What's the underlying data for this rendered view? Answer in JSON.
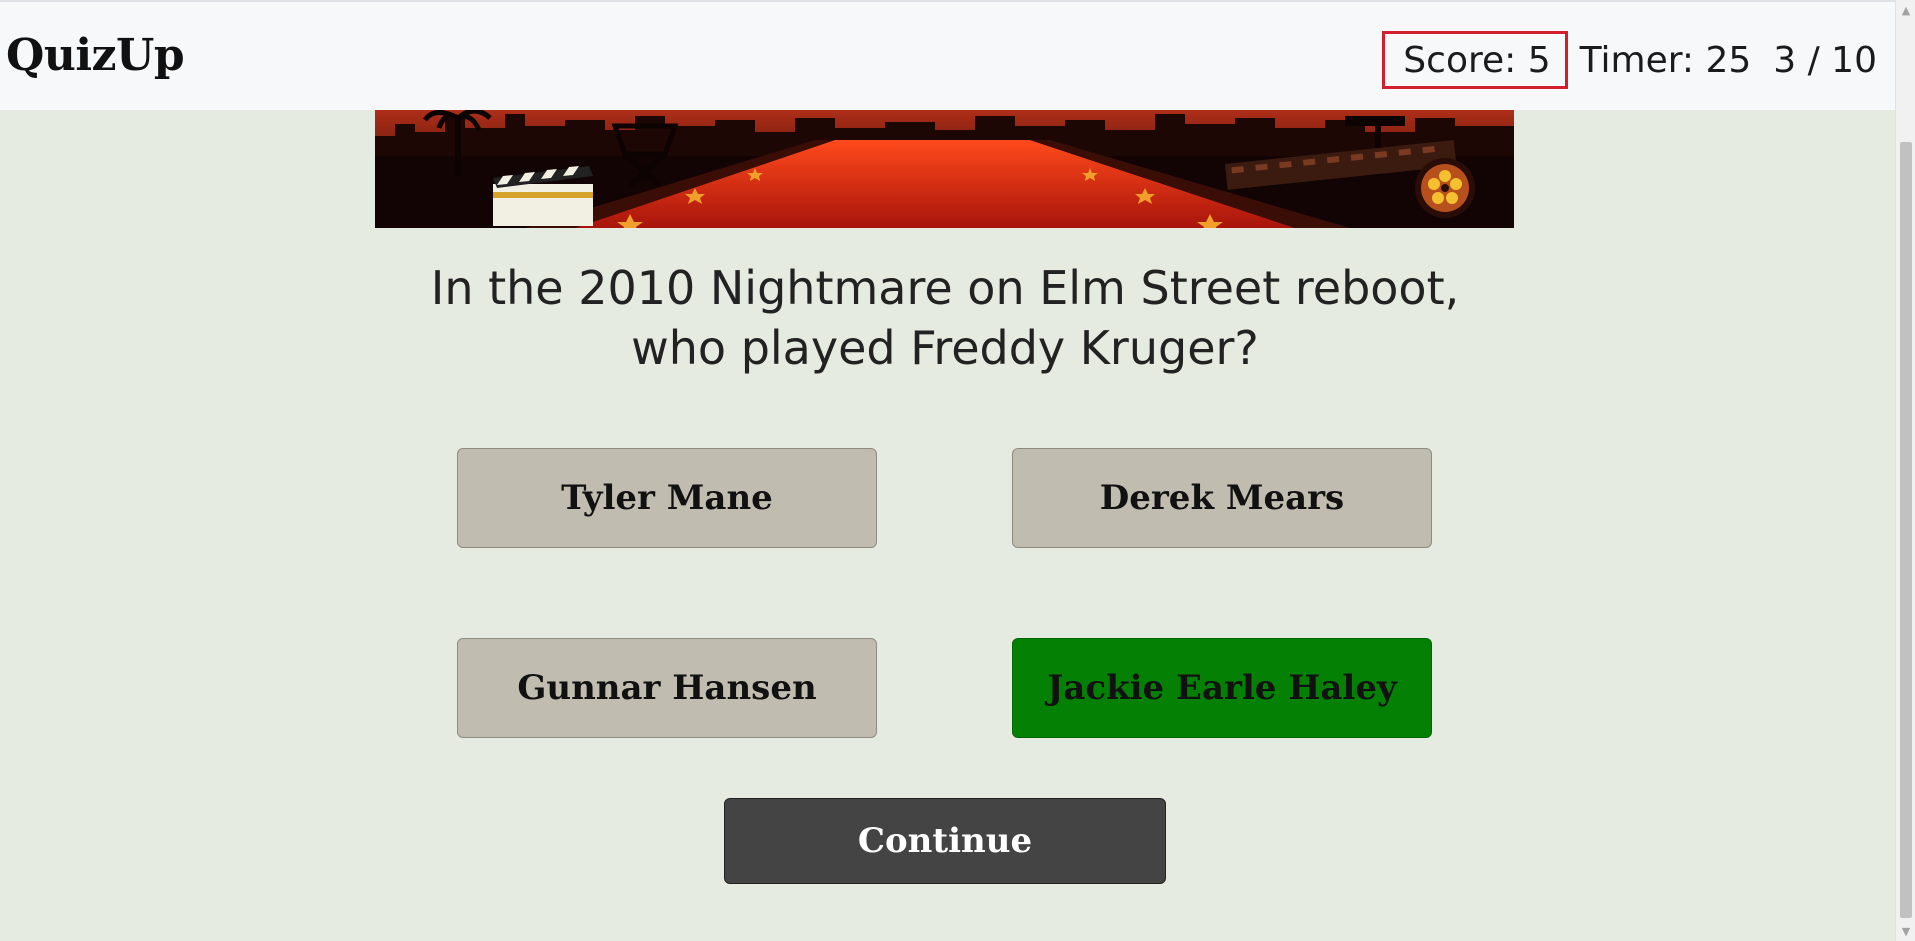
{
  "app": {
    "brand": "QuizUp"
  },
  "stats": {
    "score": "Score: 5",
    "timer": "Timer: 25",
    "progress": "3 / 10"
  },
  "question": {
    "line1": "In the 2010 Nightmare on Elm Street reboot,",
    "line2": "who played Freddy Kruger?"
  },
  "answers": [
    {
      "label": "Tyler Mane",
      "state": "neutral"
    },
    {
      "label": "Derek Mears",
      "state": "neutral"
    },
    {
      "label": "Gunnar Hansen",
      "state": "neutral"
    },
    {
      "label": "Jackie Earle Haley",
      "state": "correct"
    }
  ],
  "actions": {
    "continue_label": "Continue"
  },
  "colors": {
    "background": "#e6ebe1",
    "answer_default": "#c0bcaf",
    "answer_correct": "#048104",
    "continue_bg": "#444444",
    "score_highlight": "#d21f2b"
  },
  "icons": {
    "banner": "red-carpet-hollywood-banner",
    "scroll_up": "scroll-up-arrow-icon",
    "scroll_down": "scroll-down-arrow-icon"
  }
}
